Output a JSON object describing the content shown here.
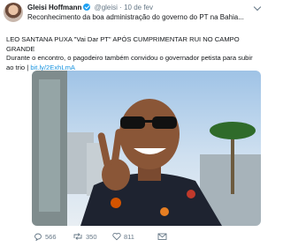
{
  "tweet": {
    "author_name": "Gleisi Hoffmann",
    "handle": "@gleisi",
    "separator": "·",
    "date": "10 de fev",
    "first_line": "Reconhecimento da boa administração do governo do PT na Bahia...",
    "headline": "LEO SANTANA PUXA \"Vai Dar PT\" APÓS CUMPRIMENTAR RUI NO CAMPO GRANDE",
    "text": "Durante o encontro, o pagodeiro também convidou o governador petista para subir ao trio |",
    "link": "bit.ly/2ExhLmA"
  },
  "actions": {
    "replies": "566",
    "retweets": "350",
    "likes": "811"
  },
  "icons": {
    "verified": "verified-badge-icon",
    "menu": "chevron-down-icon",
    "reply": "reply-icon",
    "retweet": "retweet-icon",
    "like": "heart-icon",
    "message": "envelope-icon"
  },
  "colors": {
    "accent": "#1da1f2",
    "link": "#1b95e0",
    "muted": "#657786"
  }
}
